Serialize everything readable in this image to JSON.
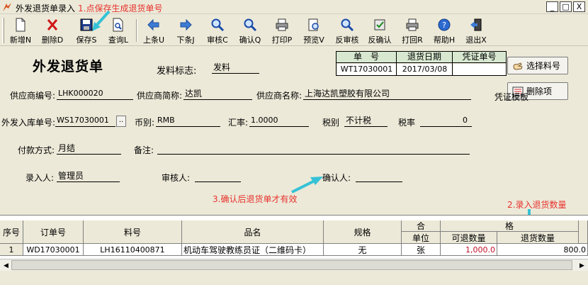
{
  "window": {
    "title": "外发退货单录入",
    "annotation": "1.点保存生成退货单号",
    "buttons": [
      "_",
      "□",
      "X"
    ]
  },
  "toolbar": [
    {
      "label": "新增N",
      "icon": "new-doc-icon"
    },
    {
      "label": "删除D",
      "icon": "delete-x-icon"
    },
    {
      "label": "保存S",
      "icon": "save-disk-icon"
    },
    {
      "label": "查询L",
      "icon": "query-doc-icon"
    },
    {
      "label": "上条U",
      "icon": "arrow-left-icon"
    },
    {
      "label": "下条J",
      "icon": "arrow-right-icon"
    },
    {
      "label": "审核C",
      "icon": "audit-magnifier-icon"
    },
    {
      "label": "确认Q",
      "icon": "confirm-magnifier-icon"
    },
    {
      "label": "打印P",
      "icon": "printer-icon"
    },
    {
      "label": "预览V",
      "icon": "preview-icon"
    },
    {
      "label": "反审核",
      "icon": "unaudit-magnifier-icon"
    },
    {
      "label": "反确认",
      "icon": "unconfirm-icon"
    },
    {
      "label": "打回R",
      "icon": "return-printer-icon"
    },
    {
      "label": "帮助H",
      "icon": "help-icon"
    },
    {
      "label": "退出X",
      "icon": "exit-icon"
    }
  ],
  "form": {
    "title": "外发退货单",
    "issue_flag_label": "发料标志:",
    "issue_flag_value": "发料",
    "return_table": {
      "headers": [
        "单　号",
        "退货日期",
        "凭证单号"
      ],
      "values": [
        "WT17030001",
        "2017/03/08",
        ""
      ]
    },
    "supplier_code_label": "供应商编号:",
    "supplier_code": "LHK000020",
    "supplier_short_label": "供应商简称:",
    "supplier_short": "达凯",
    "supplier_name_label": "供应商名称:",
    "supplier_name": "上海达凯塑胶有限公司",
    "voucher_template_label": "凭证模板",
    "inbound_no_label": "外发入库单号:",
    "inbound_no": "WS17030001",
    "currency_label": "币别:",
    "currency": "RMB",
    "rate_label": "汇率:",
    "rate": "1.0000",
    "tax_type_label": "税别",
    "tax_type": "不计税",
    "tax_rate_label": "税率",
    "tax_rate": "0",
    "payment_label": "付款方式:",
    "payment": "月结",
    "remark_label": "备注:",
    "remark": "",
    "entered_by_label": "录入人:",
    "entered_by": "管理员",
    "auditor_label": "审核人:",
    "auditor": "",
    "confirmer_label": "确认人:",
    "confirmer": ""
  },
  "side_buttons": {
    "select_item": "选择料号",
    "delete_item": "删除项"
  },
  "annotations": {
    "confirm_note": "3.确认后退货单才有效",
    "qty_note": "2.录入退货数量"
  },
  "grid": {
    "group_headers": [
      "合",
      "格"
    ],
    "headers": [
      "序号",
      "订单号",
      "料号",
      "品名",
      "规格",
      "单位",
      "可退数量",
      "退货数量"
    ],
    "rows": [
      {
        "seq": "1",
        "order": "WD17030001",
        "item": "LH16110400871",
        "name": "机动车驾驶教练员证（二维码卡）",
        "spec": "无",
        "unit": "张",
        "returnable": "1,000.0",
        "return_qty": "800.0"
      }
    ]
  }
}
